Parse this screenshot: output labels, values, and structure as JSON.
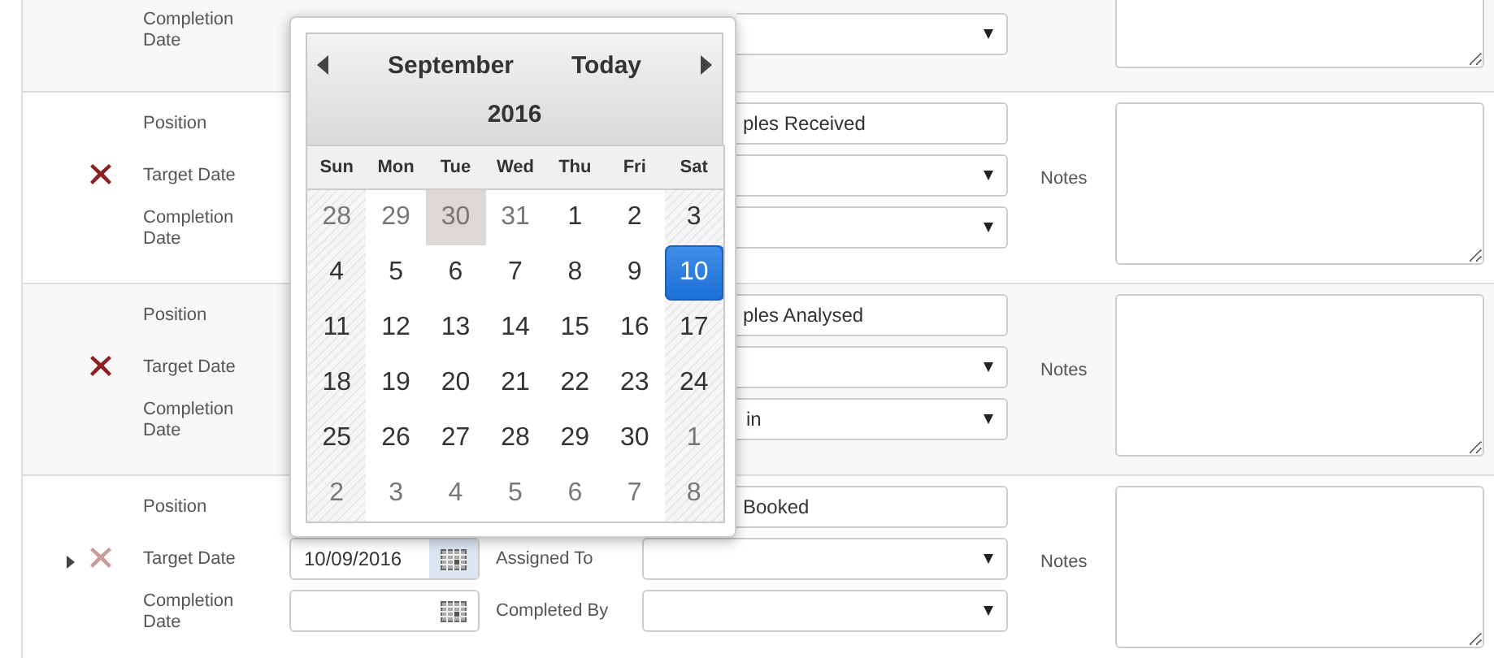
{
  "tasks": [
    {
      "completion_label": "Completion Date"
    },
    {
      "current": false,
      "position_label": "Position",
      "position": "ples Received",
      "target_label": "Target Date",
      "completion_label": "Completion Date",
      "notes_label": "Notes"
    },
    {
      "current": false,
      "position_label": "Position",
      "position": "ples Analysed",
      "target_label": "Target Date",
      "completion_label": "Completion Date",
      "completed_value": "in",
      "notes_label": "Notes"
    },
    {
      "current": true,
      "position_label": "Position",
      "position": "Booked",
      "target_label": "Target Date",
      "target_value": "10/09/2016",
      "picker_open": true,
      "completion_label": "Completion Date",
      "assigned_label": "Assigned To",
      "completed_label": "Completed By",
      "notes_label": "Notes"
    }
  ],
  "calendar": {
    "month": "September",
    "today": "Today",
    "year": "2016",
    "weekdays": [
      "Sun",
      "Mon",
      "Tue",
      "Wed",
      "Thu",
      "Fri",
      "Sat"
    ],
    "weeks": [
      [
        {
          "day": "28",
          "outside": true,
          "selected": false,
          "hovered": false
        },
        {
          "day": "29",
          "outside": true,
          "selected": false,
          "hovered": false
        },
        {
          "day": "30",
          "outside": true,
          "selected": false,
          "hovered": true
        },
        {
          "day": "31",
          "outside": true,
          "selected": false,
          "hovered": false
        },
        {
          "day": "1",
          "outside": false,
          "selected": false,
          "hovered": false
        },
        {
          "day": "2",
          "outside": false,
          "selected": false,
          "hovered": false
        },
        {
          "day": "3",
          "outside": false,
          "selected": false,
          "hovered": false
        }
      ],
      [
        {
          "day": "4",
          "outside": false,
          "selected": false,
          "hovered": false
        },
        {
          "day": "5",
          "outside": false,
          "selected": false,
          "hovered": false
        },
        {
          "day": "6",
          "outside": false,
          "selected": false,
          "hovered": false
        },
        {
          "day": "7",
          "outside": false,
          "selected": false,
          "hovered": false
        },
        {
          "day": "8",
          "outside": false,
          "selected": false,
          "hovered": false
        },
        {
          "day": "9",
          "outside": false,
          "selected": false,
          "hovered": false
        },
        {
          "day": "10",
          "outside": false,
          "selected": true,
          "hovered": false
        }
      ],
      [
        {
          "day": "11",
          "outside": false,
          "selected": false,
          "hovered": false
        },
        {
          "day": "12",
          "outside": false,
          "selected": false,
          "hovered": false
        },
        {
          "day": "13",
          "outside": false,
          "selected": false,
          "hovered": false
        },
        {
          "day": "14",
          "outside": false,
          "selected": false,
          "hovered": false
        },
        {
          "day": "15",
          "outside": false,
          "selected": false,
          "hovered": false
        },
        {
          "day": "16",
          "outside": false,
          "selected": false,
          "hovered": false
        },
        {
          "day": "17",
          "outside": false,
          "selected": false,
          "hovered": false
        }
      ],
      [
        {
          "day": "18",
          "outside": false,
          "selected": false,
          "hovered": false
        },
        {
          "day": "19",
          "outside": false,
          "selected": false,
          "hovered": false
        },
        {
          "day": "20",
          "outside": false,
          "selected": false,
          "hovered": false
        },
        {
          "day": "21",
          "outside": false,
          "selected": false,
          "hovered": false
        },
        {
          "day": "22",
          "outside": false,
          "selected": false,
          "hovered": false
        },
        {
          "day": "23",
          "outside": false,
          "selected": false,
          "hovered": false
        },
        {
          "day": "24",
          "outside": false,
          "selected": false,
          "hovered": false
        }
      ],
      [
        {
          "day": "25",
          "outside": false,
          "selected": false,
          "hovered": false
        },
        {
          "day": "26",
          "outside": false,
          "selected": false,
          "hovered": false
        },
        {
          "day": "27",
          "outside": false,
          "selected": false,
          "hovered": false
        },
        {
          "day": "28",
          "outside": false,
          "selected": false,
          "hovered": false
        },
        {
          "day": "29",
          "outside": false,
          "selected": false,
          "hovered": false
        },
        {
          "day": "30",
          "outside": false,
          "selected": false,
          "hovered": false
        },
        {
          "day": "1",
          "outside": true,
          "selected": false,
          "hovered": false
        }
      ],
      [
        {
          "day": "2",
          "outside": true,
          "selected": false,
          "hovered": false
        },
        {
          "day": "3",
          "outside": true,
          "selected": false,
          "hovered": false
        },
        {
          "day": "4",
          "outside": true,
          "selected": false,
          "hovered": false
        },
        {
          "day": "5",
          "outside": true,
          "selected": false,
          "hovered": false
        },
        {
          "day": "6",
          "outside": true,
          "selected": false,
          "hovered": false
        },
        {
          "day": "7",
          "outside": true,
          "selected": false,
          "hovered": false
        },
        {
          "day": "8",
          "outside": true,
          "selected": false,
          "hovered": false
        }
      ]
    ]
  }
}
